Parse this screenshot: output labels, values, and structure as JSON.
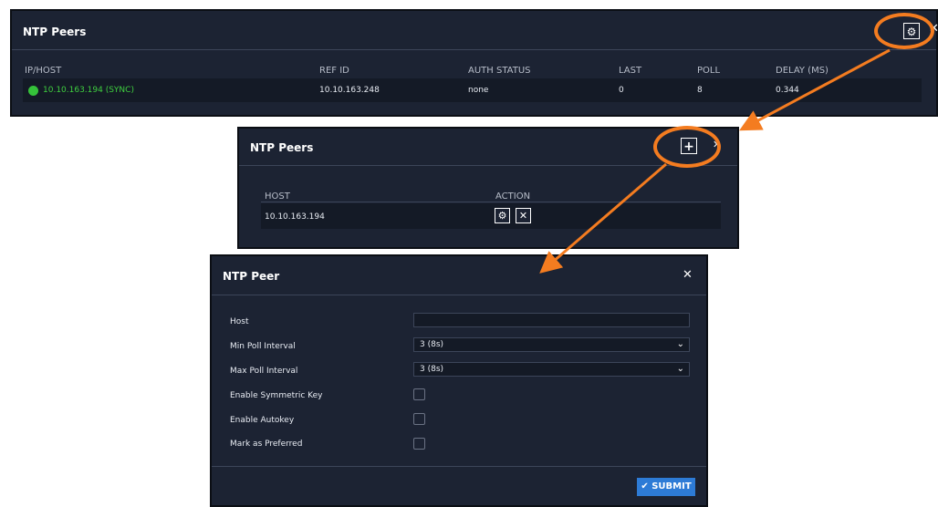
{
  "panel1": {
    "title": "NTP Peers",
    "settings_icon": "gear-icon",
    "columns": [
      "IP/HOST",
      "REF ID",
      "AUTH STATUS",
      "LAST",
      "POLL",
      "DELAY (MS)"
    ],
    "row": {
      "host": "10.10.163.194 (SYNC)",
      "ref_id": "10.10.163.248",
      "auth_status": "none",
      "last": "0",
      "poll": "8",
      "delay": "0.344"
    }
  },
  "panel2": {
    "title": "NTP Peers",
    "columns": [
      "HOST",
      "ACTION"
    ],
    "row": {
      "host": "10.10.163.194"
    },
    "add_icon": "plus-icon",
    "close_icon": "close-icon"
  },
  "panel3": {
    "title": "NTP Peer",
    "fields": {
      "host": {
        "label": "Host",
        "value": ""
      },
      "min_poll": {
        "label": "Min Poll Interval",
        "value": "3 (8s)"
      },
      "max_poll": {
        "label": "Max Poll Interval",
        "value": "3 (8s)"
      },
      "sym_key": {
        "label": "Enable Symmetric Key"
      },
      "autokey": {
        "label": "Enable Autokey"
      },
      "preferred": {
        "label": "Mark as Preferred"
      }
    },
    "submit_label": "SUBMIT",
    "close_icon": "close-icon"
  },
  "colors": {
    "panel_bg": "#1c2333",
    "accent": "#f47c20",
    "sync_green": "#35c23a",
    "submit_blue": "#2d7bd6"
  }
}
